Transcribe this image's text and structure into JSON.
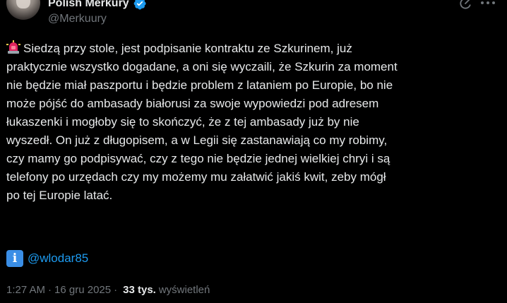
{
  "header": {
    "display_name": "Polish Merkury",
    "handle": "@Merkuury",
    "verified": true,
    "icons": {
      "verified": "verified-badge-icon",
      "grok": "grok-icon",
      "more": "more-icon"
    }
  },
  "body": {
    "leading_emoji": "police-car-light-icon",
    "text": "Siedzą przy stole, jest podpisanie kontraktu ze Szkurinem, już\npraktycznie wszystko dogadane, a oni się wyczaili, że Szkurin za moment\nnie będzie miał paszportu i będzie problem z lataniem po Europie, bo nie\nmoże pójść do ambasady białorusi za swoje wypowiedzi pod adresem\nłukaszenki i mogłoby się to skończyć, że z tej ambasady już by nie\nwyszedł. On już z długopisem, a w Legii się zastanawiają co my robimy,\nczy mamy go podpisywać, czy z tego nie będzie jednej wielkiej chryi i są\ntelefony po urzędach czy my możemy mu załatwić jakiś kwit, zeby mógł\npo tej Europie latać.",
    "info_emoji_glyph": "i",
    "mention": "@wlodar85"
  },
  "meta": {
    "time": "1:27 AM",
    "separator": "·",
    "date": "16 gru 2025",
    "views_count": "33 tys.",
    "views_label": "wyświetleń"
  },
  "colors": {
    "background": "#000000",
    "text_primary": "#e7e9ea",
    "text_secondary": "#71767b",
    "link": "#1d9bf0",
    "verified": "#1d9bf0",
    "siren": "#e0245e",
    "info_box": "#3a8ee6"
  }
}
